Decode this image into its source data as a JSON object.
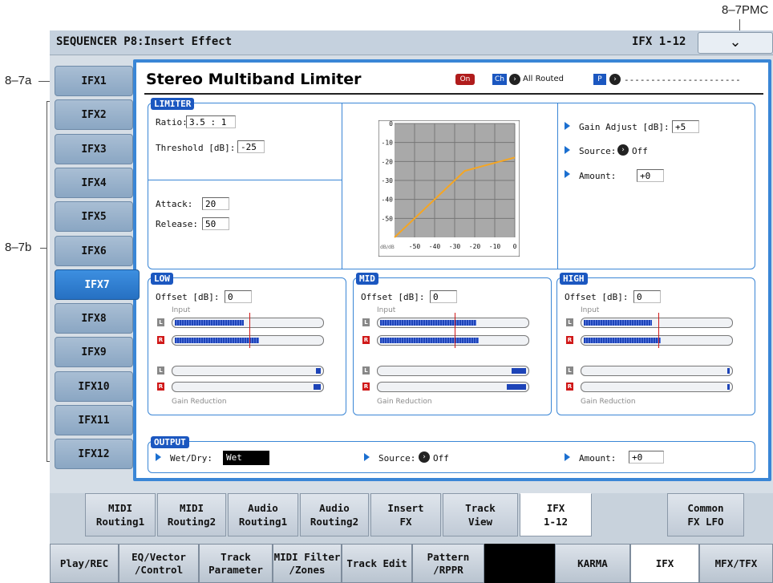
{
  "callouts": {
    "pmc": "8–7PMC",
    "a": "8–7a",
    "b": "8–7b"
  },
  "header": {
    "title": "SEQUENCER P8:Insert Effect",
    "range": "IFX 1-12",
    "menu_icon": "down-arrow-icon"
  },
  "ifx_tabs": [
    "IFX1",
    "IFX2",
    "IFX3",
    "IFX4",
    "IFX5",
    "IFX6",
    "IFX7",
    "IFX8",
    "IFX9",
    "IFX10",
    "IFX11",
    "IFX12"
  ],
  "selected_ifx": "IFX7",
  "effect": {
    "name": "Stereo Multiband Limiter",
    "on_label": "On",
    "ch_label": "Ch",
    "routing": "All Routed",
    "p_label": "P",
    "p_value": "----------------------"
  },
  "limiter": {
    "label": "LIMITER",
    "ratio_label": "Ratio:",
    "ratio": "3.5 : 1",
    "threshold_label": "Threshold [dB]:",
    "threshold": "-25",
    "attack_label": "Attack:",
    "attack": "20",
    "release_label": "Release:",
    "release": "50",
    "gain_adjust_label": "Gain Adjust [dB]:",
    "gain_adjust": "+5",
    "source_label": "Source:",
    "source": "Off",
    "amount_label": "Amount:",
    "amount": "+0"
  },
  "chart_data": {
    "type": "line",
    "y_ticks": [
      "0",
      "-10",
      "-20",
      "-30",
      "-40",
      "-50"
    ],
    "x_ticks": [
      "-50",
      "-40",
      "-30",
      "-20",
      "-10",
      "0"
    ],
    "unit_label": "dB/dB",
    "x": [
      -60,
      -25,
      0
    ],
    "y": [
      -60,
      -25,
      -17.9
    ],
    "xlim": [
      -60,
      0
    ],
    "ylim": [
      -60,
      0
    ],
    "grid": true,
    "line_color": "#f5a623",
    "background": "#a9a9a9"
  },
  "bands": [
    {
      "label": "LOW",
      "offset_label": "Offset [dB]:",
      "offset": "0",
      "input_label": "Input",
      "gr_label": "Gain Reduction",
      "in_l": 0.47,
      "in_r": 0.57,
      "gr_l": 0.03,
      "gr_r": 0.05,
      "thr": 0.51
    },
    {
      "label": "MID",
      "offset_label": "Offset [dB]:",
      "offset": "0",
      "input_label": "Input",
      "gr_label": "Gain Reduction",
      "in_l": 0.65,
      "in_r": 0.67,
      "gr_l": 0.1,
      "gr_r": 0.13,
      "thr": 0.51
    },
    {
      "label": "HIGH",
      "offset_label": "Offset [dB]:",
      "offset": "0",
      "input_label": "Input",
      "gr_label": "Gain Reduction",
      "in_l": 0.46,
      "in_r": 0.52,
      "gr_l": 0.01,
      "gr_r": 0.01,
      "thr": 0.51
    }
  ],
  "output": {
    "label": "OUTPUT",
    "wetdry_label": "Wet/Dry:",
    "wetdry": "Wet",
    "source_label": "Source:",
    "source": "Off",
    "amount_label": "Amount:",
    "amount": "+0"
  },
  "page_tabs": [
    {
      "l1": "MIDI",
      "l2": "Routing1"
    },
    {
      "l1": "MIDI",
      "l2": "Routing2"
    },
    {
      "l1": "Audio",
      "l2": "Routing1"
    },
    {
      "l1": "Audio",
      "l2": "Routing2"
    },
    {
      "l1": "Insert",
      "l2": "FX"
    },
    {
      "l1": "Track",
      "l2": "View"
    },
    {
      "l1": "IFX",
      "l2": "1-12"
    },
    {
      "l1": "Common",
      "l2": "FX LFO"
    }
  ],
  "mode_tabs": [
    {
      "l1": "Play/REC",
      "l2": ""
    },
    {
      "l1": "EQ/Vector",
      "l2": "/Control"
    },
    {
      "l1": "Track",
      "l2": "Parameter"
    },
    {
      "l1": "MIDI Filter",
      "l2": "/Zones"
    },
    {
      "l1": "Track Edit",
      "l2": ""
    },
    {
      "l1": "Pattern",
      "l2": "/RPPR"
    },
    {
      "l1": "",
      "l2": ""
    },
    {
      "l1": "KARMA",
      "l2": ""
    },
    {
      "l1": "IFX",
      "l2": ""
    },
    {
      "l1": "MFX/TFX",
      "l2": ""
    }
  ]
}
